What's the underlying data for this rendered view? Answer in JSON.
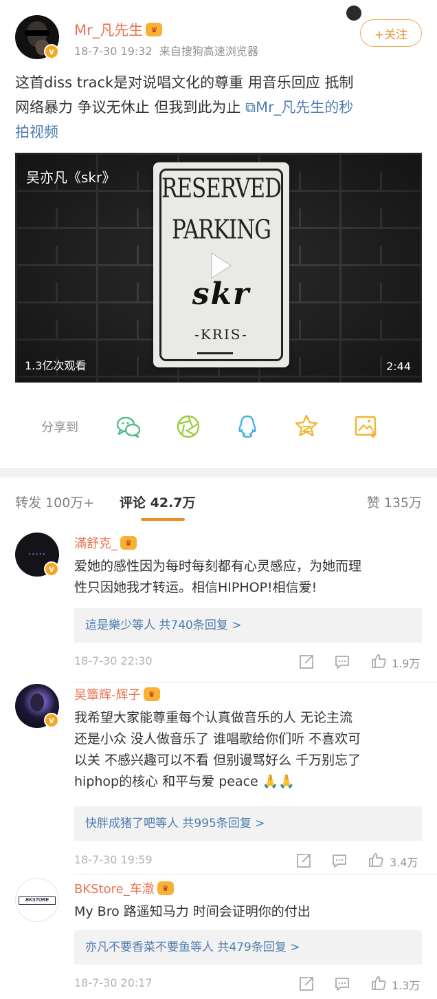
{
  "post": {
    "username": "Mr_凡先生",
    "time": "18-7-30 19:32",
    "source": "来自搜狗高速浏览器",
    "follow_label": "+关注",
    "text_lines": [
      "这首diss track是对说唱文化的尊重  用音乐回应  抵制",
      "网络暴力 争议无休止 但我到此为止 "
    ],
    "link_text_a": "Mr_凡先生的秒",
    "link_text_b": "拍视频"
  },
  "video": {
    "title": "吴亦凡《skr》",
    "sign_line1": "RESERVED",
    "sign_line2": "PARKING",
    "sign_main": "skr",
    "sign_artist": "-KRIS-",
    "views": "1.3亿次观看",
    "duration": "2:44"
  },
  "share": {
    "label": "分享到",
    "icons": [
      "wechat-icon",
      "moments-icon",
      "qq-icon",
      "qzone-icon",
      "save-image-icon"
    ]
  },
  "tabs": {
    "repost": "转发 100万+",
    "comments": "评论 42.7万",
    "likes": "赞 135万"
  },
  "comments": [
    {
      "username": "滿舒克_",
      "text_lines": [
        "爱她的感性因为每时每刻都有心灵感应，为她而理",
        "性只因她我才转运。相信HIPHOP!相信爱!"
      ],
      "reply_summary": "這是樂少等人  共740条回复 >",
      "time": "18-7-30 22:30",
      "likes": "1.9万"
    },
    {
      "username": "吴簟辉-辉子",
      "text_lines": [
        "我希望大家能尊重每个认真做音乐的人 无论主流",
        "还是小众 没人做音乐了 谁唱歌给你们听 不喜欢可",
        "以关 不感兴趣可以不看 但别谩骂好么  千万别忘了",
        "hiphop的核心 和平与爱 peace 🙏🙏"
      ],
      "reply_summary": "快胖成猪了吧等人  共995条回复 >",
      "time": "18-7-30 19:59",
      "likes": "3.4万"
    },
    {
      "username": "BKStore_车澈",
      "avatar_text": "BKSTORE",
      "text_lines": [
        "My Bro  路遥知马力 时间会证明你的付出"
      ],
      "reply_summary": "亦凡不要香菜不要鱼等人  共479条回复 >",
      "time": "18-7-30 20:17",
      "likes": "1.3万"
    }
  ],
  "colors": {
    "username": "#eb7350",
    "link": "#507daf",
    "accent": "#f08c28",
    "muted": "#939393"
  }
}
